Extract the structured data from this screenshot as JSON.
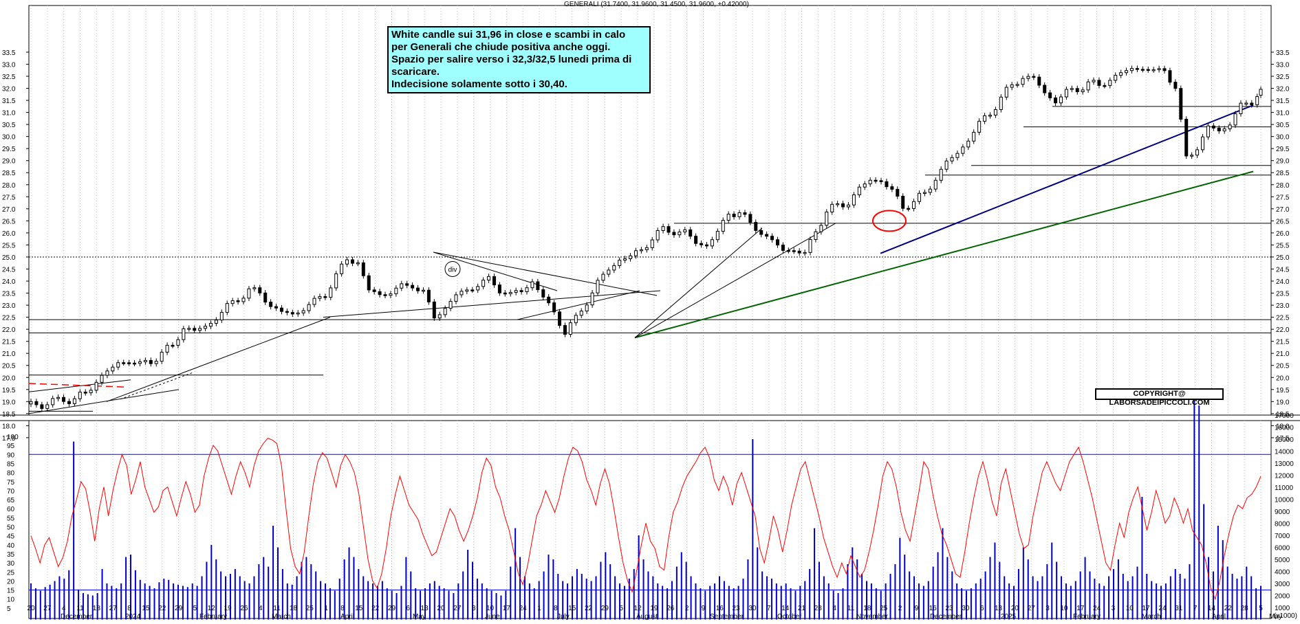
{
  "chart_data": [
    {
      "type": "candlestick",
      "title": "GENERALI (31.7400, 31.9600, 31.4500, 31.9600, +0.42000)",
      "y_ticks": [
        "17.5",
        "18.0",
        "18.5",
        "19.0",
        "19.5",
        "20.0",
        "20.5",
        "21.0",
        "21.5",
        "22.0",
        "22.5",
        "23.0",
        "23.5",
        "24.0",
        "24.5",
        "25.0",
        "25.5",
        "26.0",
        "26.5",
        "27.0",
        "27.5",
        "28.0",
        "28.5",
        "29.0",
        "29.5",
        "30.0",
        "30.5",
        "31.0",
        "31.5",
        "32.0",
        "32.5",
        "33.0",
        "33.5"
      ],
      "ylim": [
        17.5,
        33.5
      ],
      "horizontal_levels": [
        {
          "price": 25.0,
          "style": "dotted"
        },
        {
          "price": 22.4,
          "style": "solid"
        },
        {
          "price": 21.85,
          "style": "solid"
        },
        {
          "price": 26.4,
          "style": "solid"
        },
        {
          "price": 28.4,
          "style": "solid"
        },
        {
          "price": 28.8,
          "style": "solid"
        },
        {
          "price": 30.4,
          "style": "solid"
        },
        {
          "price": 31.25,
          "style": "solid"
        },
        {
          "price": 20.1,
          "style": "solid"
        }
      ],
      "close_path": [
        [
          0,
          19.0
        ],
        [
          6,
          18.8
        ],
        [
          12,
          19.0
        ],
        [
          18,
          19.1
        ],
        [
          24,
          19.1
        ],
        [
          30,
          19.3
        ],
        [
          36,
          19.9
        ],
        [
          42,
          20.2
        ],
        [
          48,
          20.6
        ],
        [
          54,
          20.7
        ],
        [
          60,
          20.5
        ],
        [
          66,
          20.7
        ],
        [
          72,
          21.0
        ],
        [
          78,
          21.3
        ],
        [
          84,
          22.1
        ],
        [
          90,
          21.9
        ],
        [
          96,
          22.1
        ],
        [
          102,
          22.5
        ],
        [
          108,
          22.9
        ],
        [
          114,
          23.3
        ],
        [
          120,
          23.6
        ],
        [
          126,
          23.5
        ],
        [
          132,
          23.0
        ],
        [
          138,
          22.7
        ],
        [
          144,
          22.6
        ],
        [
          150,
          22.9
        ],
        [
          156,
          23.1
        ],
        [
          162,
          23.5
        ],
        [
          168,
          24.2
        ],
        [
          174,
          24.9
        ],
        [
          180,
          24.8
        ],
        [
          186,
          23.6
        ],
        [
          192,
          23.4
        ],
        [
          198,
          23.6
        ],
        [
          204,
          23.7
        ],
        [
          210,
          23.9
        ],
        [
          216,
          23.5
        ],
        [
          222,
          22.5
        ],
        [
          228,
          22.9
        ],
        [
          234,
          23.4
        ],
        [
          240,
          23.6
        ],
        [
          246,
          23.9
        ],
        [
          252,
          24.0
        ],
        [
          258,
          23.7
        ],
        [
          264,
          23.4
        ],
        [
          270,
          23.6
        ],
        [
          276,
          24.0
        ],
        [
          282,
          23.3
        ],
        [
          288,
          22.7
        ],
        [
          294,
          21.9
        ],
        [
          300,
          22.4
        ],
        [
          306,
          23.2
        ],
        [
          312,
          23.9
        ],
        [
          318,
          24.5
        ],
        [
          324,
          24.9
        ],
        [
          330,
          25.0
        ],
        [
          336,
          25.3
        ],
        [
          342,
          25.8
        ],
        [
          348,
          26.1
        ],
        [
          354,
          26.1
        ],
        [
          360,
          26.0
        ],
        [
          366,
          25.6
        ],
        [
          372,
          25.5
        ],
        [
          378,
          26.0
        ],
        [
          384,
          26.8
        ],
        [
          390,
          26.9
        ],
        [
          396,
          26.3
        ],
        [
          402,
          26.1
        ],
        [
          408,
          25.6
        ],
        [
          414,
          25.3
        ],
        [
          420,
          25.3
        ],
        [
          426,
          25.1
        ],
        [
          432,
          26.1
        ],
        [
          438,
          26.9
        ],
        [
          444,
          27.1
        ],
        [
          450,
          27.3
        ],
        [
          456,
          27.8
        ],
        [
          462,
          28.2
        ],
        [
          468,
          28.2
        ],
        [
          474,
          27.7
        ],
        [
          480,
          27.1
        ],
        [
          486,
          27.3
        ],
        [
          492,
          27.6
        ],
        [
          498,
          28.3
        ],
        [
          504,
          28.9
        ],
        [
          510,
          29.3
        ],
        [
          516,
          29.9
        ],
        [
          522,
          30.5
        ],
        [
          528,
          31.0
        ],
        [
          534,
          31.6
        ],
        [
          540,
          32.1
        ],
        [
          546,
          32.5
        ],
        [
          552,
          32.4
        ],
        [
          558,
          31.8
        ],
        [
          564,
          31.5
        ],
        [
          570,
          31.8
        ],
        [
          576,
          32.0
        ],
        [
          582,
          32.2
        ],
        [
          588,
          32.1
        ],
        [
          594,
          32.4
        ],
        [
          600,
          32.6
        ],
        [
          606,
          32.8
        ],
        [
          612,
          32.9
        ],
        [
          618,
          32.6
        ],
        [
          624,
          32.9
        ],
        [
          630,
          31.9
        ],
        [
          636,
          29.2
        ],
        [
          642,
          29.5
        ],
        [
          648,
          30.4
        ],
        [
          654,
          30.2
        ],
        [
          660,
          30.6
        ],
        [
          666,
          31.2
        ],
        [
          672,
          31.5
        ],
        [
          677,
          31.96
        ]
      ],
      "last_candle": {
        "open": 31.74,
        "high": 31.96,
        "low": 31.45,
        "close": 31.96,
        "change": 0.42
      }
    },
    {
      "type": "line+bar",
      "left_ticks": [
        "5",
        "10",
        "15",
        "20",
        "25",
        "30",
        "35",
        "40",
        "45",
        "50",
        "55",
        "60",
        "65",
        "70",
        "75",
        "80",
        "85",
        "90",
        "95",
        "100"
      ],
      "right_ticks": [
        "1000",
        "2000",
        "3000",
        "4000",
        "5000",
        "6000",
        "7000",
        "8000",
        "9000",
        "10000",
        "11000",
        "12000",
        "13000",
        "14000",
        "15000",
        "16000",
        "17000"
      ],
      "right_unit": "(x1000)",
      "oscillator_levels": [
        90,
        15
      ],
      "oscillator": [
        45,
        38,
        30,
        40,
        44,
        36,
        28,
        33,
        42,
        56,
        65,
        75,
        71,
        58,
        42,
        60,
        72,
        56,
        70,
        81,
        90,
        84,
        68,
        76,
        86,
        72,
        65,
        58,
        61,
        70,
        72,
        64,
        56,
        66,
        75,
        68,
        58,
        62,
        78,
        88,
        95,
        92,
        84,
        76,
        68,
        78,
        86,
        80,
        72,
        84,
        92,
        96,
        99,
        98,
        96,
        84,
        60,
        38,
        28,
        24,
        36,
        56,
        74,
        86,
        91,
        88,
        80,
        72,
        84,
        90,
        86,
        80,
        68,
        50,
        32,
        20,
        16,
        24,
        38,
        56,
        68,
        78,
        70,
        62,
        58,
        54,
        46,
        40,
        34,
        36,
        44,
        52,
        60,
        56,
        48,
        42,
        48,
        56,
        66,
        80,
        88,
        84,
        72,
        66,
        56,
        48,
        36,
        24,
        18,
        28,
        42,
        56,
        62,
        70,
        64,
        58,
        66,
        78,
        88,
        94,
        92,
        86,
        76,
        70,
        62,
        74,
        82,
        74,
        60,
        44,
        30,
        20,
        14,
        26,
        40,
        52,
        42,
        38,
        28,
        26,
        44,
        58,
        64,
        72,
        78,
        82,
        86,
        91,
        94,
        88,
        76,
        70,
        78,
        72,
        62,
        74,
        80,
        72,
        64,
        56,
        38,
        30,
        42,
        56,
        48,
        36,
        48,
        62,
        72,
        82,
        86,
        76,
        66,
        56,
        44,
        36,
        28,
        22,
        30,
        24,
        34,
        28,
        22,
        26,
        36,
        48,
        62,
        78,
        86,
        82,
        72,
        58,
        48,
        42,
        56,
        70,
        86,
        82,
        68,
        56,
        46,
        40,
        32,
        24,
        22,
        36,
        52,
        66,
        78,
        86,
        76,
        64,
        56,
        74,
        82,
        70,
        58,
        46,
        38,
        40,
        56,
        68,
        80,
        86,
        80,
        74,
        70,
        78,
        86,
        90,
        94,
        86,
        76,
        66,
        54,
        42,
        30,
        26,
        40,
        52,
        44,
        58,
        66,
        72,
        60,
        48,
        58,
        70,
        62,
        52,
        56,
        66,
        60,
        52,
        60,
        48,
        44,
        40,
        30,
        16,
        10,
        20,
        34,
        46,
        56,
        62,
        60,
        66,
        68,
        72,
        78
      ],
      "volume": [
        3000,
        2600,
        2400,
        2700,
        2900,
        3200,
        3600,
        3400,
        4100,
        14800,
        2500,
        2200,
        2100,
        2000,
        2200,
        4200,
        3000,
        2800,
        2600,
        3000,
        5200,
        5400,
        4100,
        3300,
        3000,
        2800,
        2600,
        3100,
        3400,
        3300,
        3000,
        2900,
        2800,
        2700,
        3000,
        2800,
        3600,
        4800,
        6200,
        5000,
        4000,
        3600,
        3800,
        4200,
        3600,
        3200,
        3000,
        3600,
        4600,
        5200,
        4400,
        7800,
        6000,
        4200,
        3000,
        2900,
        3600,
        4800,
        5200,
        4600,
        4000,
        3200,
        3000,
        2600,
        2400,
        3400,
        5000,
        6000,
        5200,
        4200,
        3600,
        3200,
        3000,
        2800,
        3200,
        2600,
        2400,
        2200,
        2800,
        5200,
        4000,
        2600,
        2400,
        2600,
        3000,
        3200,
        2800,
        2600,
        2400,
        2200,
        3000,
        4000,
        5800,
        4800,
        3400,
        3000,
        2600,
        2400,
        2200,
        2000,
        2400,
        4400,
        7600,
        5200,
        3600,
        3000,
        2600,
        3200,
        4000,
        5400,
        5000,
        3800,
        3200,
        3000,
        3600,
        4200,
        3800,
        3400,
        3200,
        3600,
        4800,
        5600,
        4600,
        3600,
        3000,
        2800,
        3400,
        4200,
        7000,
        5000,
        4000,
        3600,
        3000,
        2800,
        2600,
        3200,
        4400,
        5600,
        4800,
        3600,
        3000,
        2600,
        2400,
        2800,
        3000,
        3600,
        3200,
        2800,
        2600,
        2800,
        3400,
        5000,
        15000,
        6000,
        4000,
        3600,
        3400,
        3000,
        2800,
        3000,
        2600,
        2400,
        2800,
        3200,
        4200,
        7600,
        4800,
        3600,
        3000,
        2400,
        2200,
        2600,
        4600,
        6000,
        5000,
        3800,
        3200,
        3000,
        2600,
        2400,
        3000,
        3800,
        4600,
        6800,
        5400,
        4000,
        3600,
        3000,
        2800,
        3200,
        4400,
        5600,
        7600,
        5200,
        4000,
        3000,
        2600,
        2400,
        2600,
        3000,
        3400,
        4000,
        5200,
        6400,
        4800,
        3600,
        3000,
        2800,
        4200,
        6000,
        5000,
        3600,
        3200,
        3600,
        4600,
        6400,
        4800,
        3600,
        3000,
        2800,
        3200,
        4000,
        5200,
        4000,
        3400,
        3000,
        2800,
        3600,
        4200,
        5000,
        3800,
        3200,
        3600,
        4400,
        10200,
        3800,
        3200,
        3000,
        2800,
        3000,
        3600,
        4200,
        3800,
        3400,
        4600,
        18200,
        17800,
        9600,
        5200,
        4000,
        7800,
        6600,
        4400,
        3800,
        3400,
        3600,
        4400,
        3600,
        2600,
        2800
      ]
    }
  ],
  "x_labels_top": [
    "20",
    "27",
    "4",
    "11",
    "18",
    "27",
    "8",
    "15",
    "22",
    "29",
    "5",
    "12",
    "19",
    "26",
    "4",
    "11",
    "18",
    "25",
    "1",
    "8",
    "15",
    "22",
    "29",
    "6",
    "13",
    "20",
    "27",
    "3",
    "10",
    "17",
    "24",
    "1",
    "8",
    "15",
    "22",
    "29",
    "5",
    "12",
    "19",
    "26",
    "2",
    "9",
    "16",
    "23",
    "30",
    "7",
    "14",
    "21",
    "28",
    "4",
    "11",
    "18",
    "25",
    "2",
    "9",
    "16",
    "23",
    "30",
    "6",
    "13",
    "20",
    "27",
    "3",
    "10",
    "17",
    "24",
    "3",
    "10",
    "17",
    "24",
    "31",
    "7",
    "14",
    "22",
    "28",
    "5"
  ],
  "x_labels_months": [
    "December",
    "2024",
    "February",
    "March",
    "April",
    "May",
    "June",
    "July",
    "August",
    "September",
    "October",
    "November",
    "December",
    "2025",
    "February",
    "March",
    "April",
    "May"
  ],
  "annotation_lines": [
    "White candle sui 31,96 in close e scambi in calo",
    "per Generali che chiude positiva anche oggi.",
    "Spazio per salire verso i 32,3/32,5 lunedi prima di",
    "scaricare.",
    "Indecisione solamente sotto i 30,40."
  ],
  "marker_label": "div",
  "copyright": "COPYRIGHT@ LABORSADEIPICCOLI.COM",
  "colors": {
    "oscillator": "#ff0000",
    "volume": "#0000cc",
    "trend_blue": "#000080",
    "trend_green": "#006400",
    "annotation_bg": "#9fffff",
    "ellipse": "#ff0000"
  }
}
